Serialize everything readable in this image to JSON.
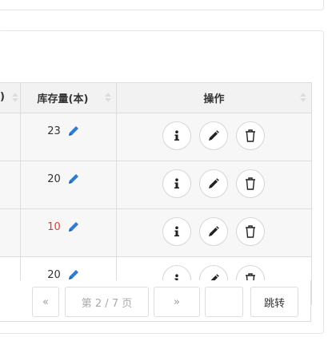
{
  "table": {
    "headers": {
      "prev_col_fragment": ")",
      "stock": "库存量(本)",
      "actions": "操作"
    },
    "rows": [
      {
        "stock": "23",
        "low": false
      },
      {
        "stock": "20",
        "low": false
      },
      {
        "stock": "10",
        "low": true
      },
      {
        "stock": "20",
        "low": false
      }
    ]
  },
  "icons": {
    "edit": "pencil-icon",
    "info": "info-icon",
    "row_edit": "pencil-icon",
    "delete": "trash-icon",
    "sort": "sort-arrows-icon",
    "prev": "double-left-icon",
    "next": "double-right-icon"
  },
  "pagination": {
    "prev_label": "«",
    "page_info": "第 2 / 7 页",
    "next_label": "»",
    "input_value": "",
    "go_label": "跳转"
  },
  "colors": {
    "low_stock": "#e53935",
    "edit_icon": "#2d7dd2",
    "border": "#dddddd",
    "header_bg": "#f2f2f2",
    "alt_row_bg": "#f7f7f7"
  }
}
